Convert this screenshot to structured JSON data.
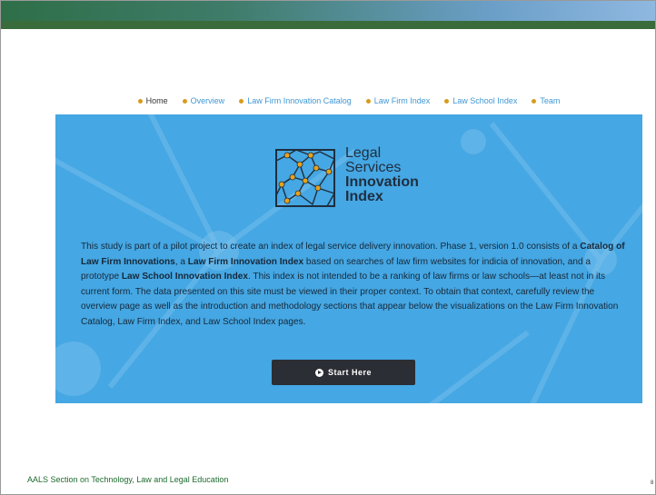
{
  "nav": {
    "items": [
      {
        "label": "Home"
      },
      {
        "label": "Overview"
      },
      {
        "label": "Law Firm Innovation Catalog"
      },
      {
        "label": "Law Firm Index"
      },
      {
        "label": "Law School Index"
      },
      {
        "label": "Team"
      }
    ]
  },
  "logo": {
    "line1": "Legal",
    "line2": "Services",
    "line3": "Innovation",
    "line4": "Index"
  },
  "intro": {
    "part1": "This study is part of a pilot project to create an index of legal service delivery innovation. Phase 1, version 1.0 consists of a ",
    "bold1": "Catalog of Law Firm Innovations",
    "part2": ", a ",
    "bold2": "Law Firm Innovation Index",
    "part3": " based on searches of law firm websites for indicia of innovation, and a prototype ",
    "bold3": "Law School Innovation Index",
    "part4": ". This index is not intended to be a ranking of law firms or law schools—at least not in its current form. The data presented on this site must be viewed in their proper context. To obtain that context, carefully review the overview page as well as the introduction and methodology sections that appear below the visualizations on the Law Firm Innovation Catalog, Law Firm Index, and Law School Index pages."
  },
  "start_button": {
    "label": "Start Here"
  },
  "footer": {
    "text": "AALS Section on Technology, Law and Legal Education"
  },
  "page_number": "8",
  "colors": {
    "hero": "#45a7e3",
    "nav_dot": "#d89b1f",
    "nav_link": "#3f97d4",
    "footer": "#1d6b2e",
    "button": "#2b2e34"
  }
}
